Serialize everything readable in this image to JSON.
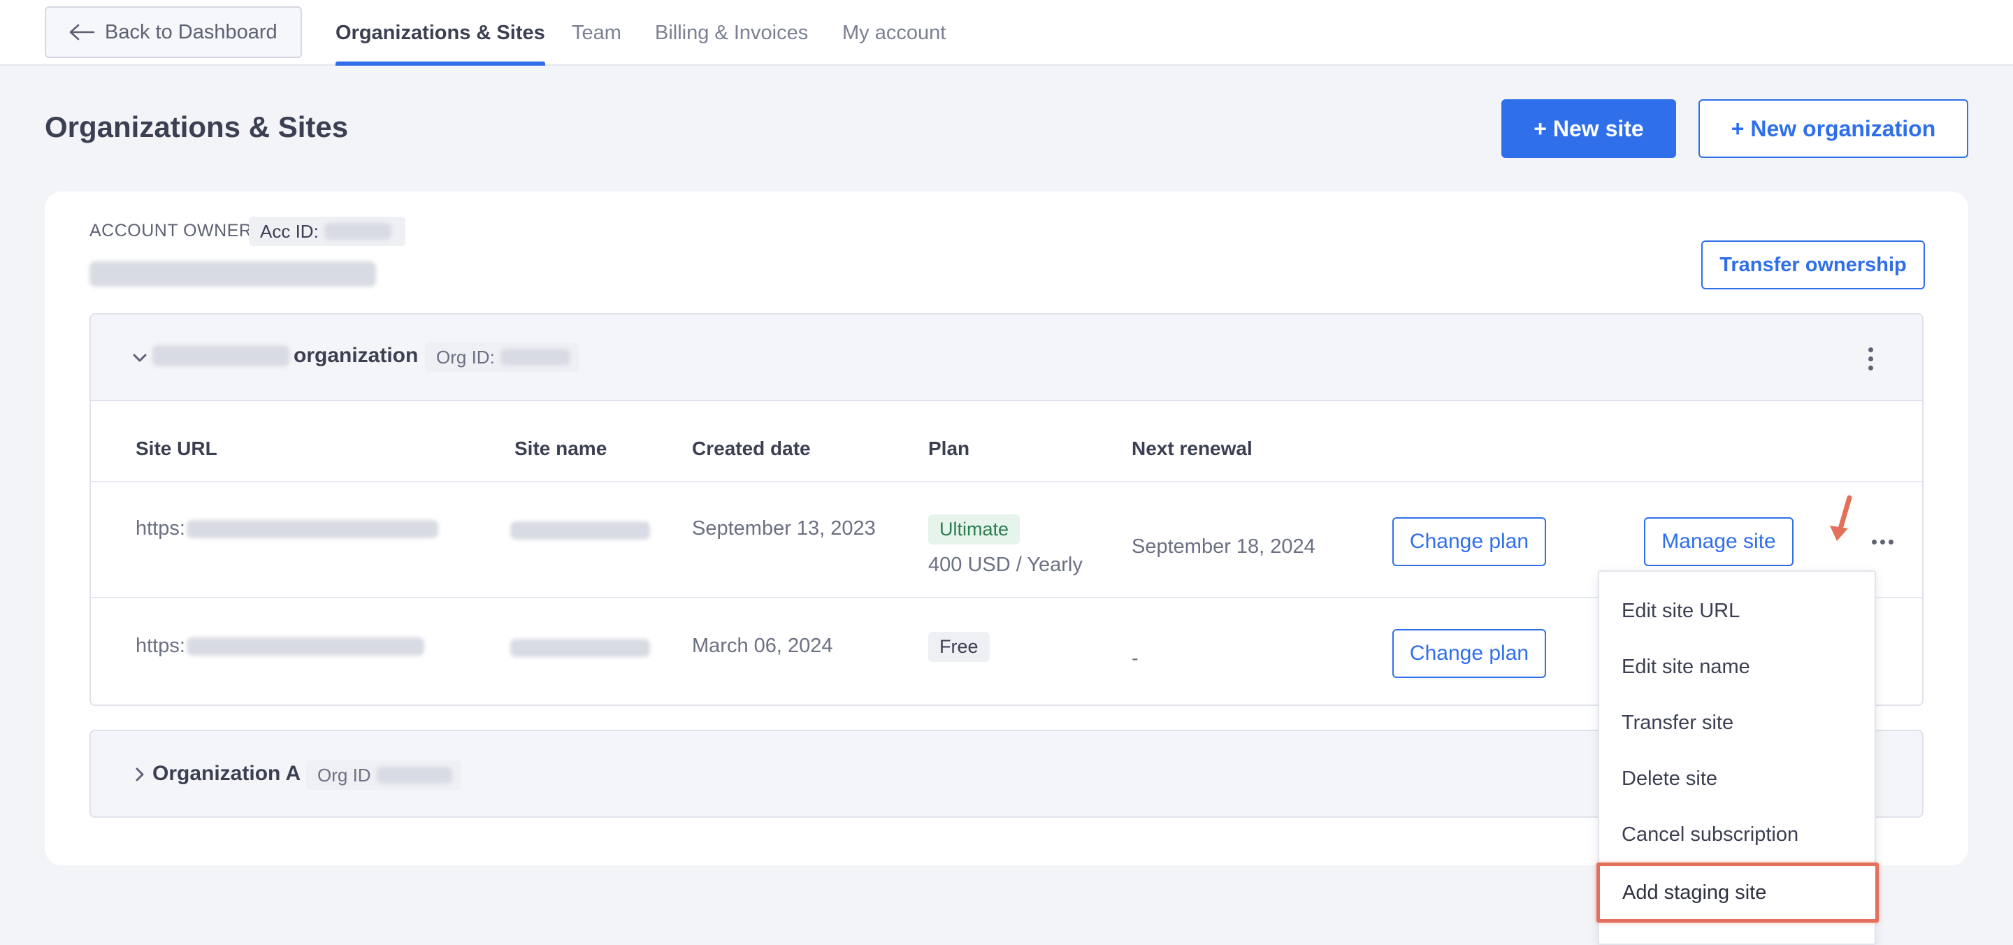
{
  "nav": {
    "back_label": "Back to Dashboard",
    "tabs": [
      {
        "label": "Organizations & Sites",
        "active": true
      },
      {
        "label": "Team"
      },
      {
        "label": "Billing & Invoices"
      },
      {
        "label": "My account"
      }
    ]
  },
  "header": {
    "title": "Organizations & Sites",
    "new_site_label": "+ New site",
    "new_org_label": "+ New organization"
  },
  "account": {
    "owner_label": "ACCOUNT OWNER",
    "acc_id_label": "Acc ID:",
    "transfer_label": "Transfer ownership"
  },
  "org": {
    "name_suffix": "organization",
    "org_id_label": "Org ID:",
    "columns": [
      "Site URL",
      "Site name",
      "Created date",
      "Plan",
      "Next renewal"
    ],
    "sites": [
      {
        "url_prefix": "https:",
        "created": "September 13, 2023",
        "plan": "Ultimate",
        "price": "400 USD / Yearly",
        "renewal": "September 18, 2024",
        "change_plan_label": "Change plan",
        "manage_label": "Manage site"
      },
      {
        "url_prefix": "https:",
        "created": "March 06, 2024",
        "plan": "Free",
        "renewal": "-",
        "change_plan_label": "Change plan"
      }
    ]
  },
  "org_a": {
    "name": "Organization A",
    "org_id_label": "Org ID"
  },
  "menu": {
    "items": [
      "Edit site URL",
      "Edit site name",
      "Transfer site",
      "Delete site",
      "Cancel subscription"
    ],
    "highlighted": "Add staging site"
  },
  "colors": {
    "accent": "#2f6fe9",
    "highlight": "#e2705a",
    "badge_green": "#2a7d4f"
  }
}
